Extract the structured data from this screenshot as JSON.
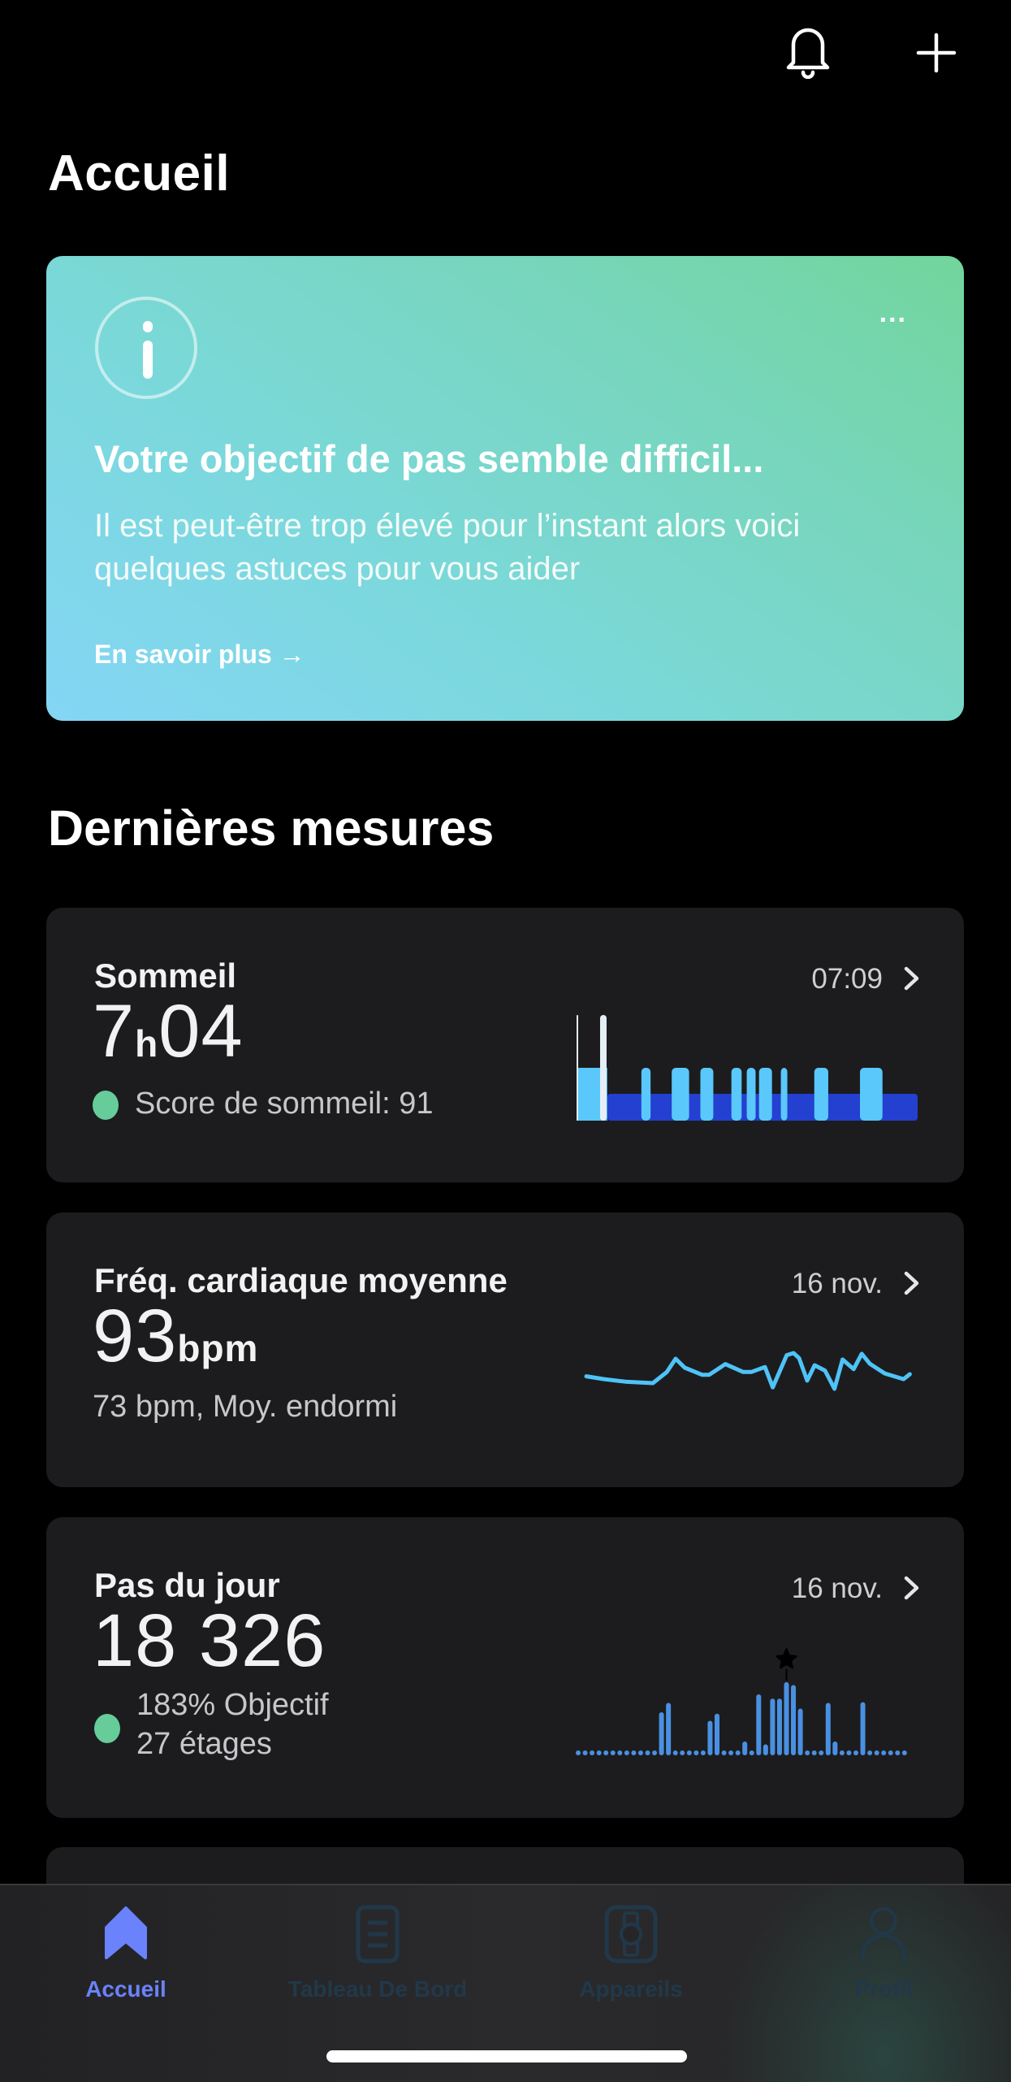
{
  "header": {
    "title": "Accueil",
    "icons": [
      "bell-icon",
      "plus-icon"
    ]
  },
  "banner": {
    "icon": "info-icon",
    "more_label": "...",
    "title": "Votre objectif de pas semble difficil...",
    "body": "Il est peut-être trop élevé pour l’instant alors voici quelques astuces pour vous aider",
    "link_label": "En savoir plus →",
    "gradient_colors": [
      "#84d6f5",
      "#72d59c"
    ]
  },
  "section": {
    "title": "Dernières mesures"
  },
  "cards": {
    "sleep": {
      "title": "Sommeil",
      "time": "07:09",
      "value_hours": "7",
      "value_h_unit": "h",
      "value_minutes": "04",
      "score_label": "Score de sommeil: 91",
      "status_color": "#66cc99"
    },
    "heart": {
      "title": "Fréq. cardiaque moyenne",
      "date": "16 nov.",
      "value": "93",
      "unit": "bpm",
      "sub_label": "73 bpm, Moy. endormi"
    },
    "steps": {
      "title": "Pas du jour",
      "date": "16 nov.",
      "value": "18 326",
      "goal_label": "183% Objectif",
      "floors_label": "27 étages",
      "status_color": "#66cc99"
    }
  },
  "chart_data": [
    {
      "name": "sleep-stages",
      "type": "bar",
      "title": "Sommeil",
      "x_unit": "fraction of night",
      "deep_base": {
        "start": 0.09,
        "end": 1.0,
        "color": "#2340d0"
      },
      "light_segments": [
        [
          0.0,
          0.09
        ],
        [
          0.19,
          0.217
        ],
        [
          0.279,
          0.33
        ],
        [
          0.363,
          0.401
        ],
        [
          0.454,
          0.484
        ],
        [
          0.499,
          0.525
        ],
        [
          0.535,
          0.573
        ],
        [
          0.599,
          0.618
        ],
        [
          0.697,
          0.738
        ],
        [
          0.831,
          0.897
        ]
      ],
      "light_color": "#5ac8fa",
      "awake_markers": [
        0.0,
        0.069
      ],
      "awake_color": "#e5eef5"
    },
    {
      "name": "heart-rate-trend",
      "type": "line",
      "title": "Fréq. cardiaque moyenne",
      "color": "#4fc3f7",
      "y_unit": "relative (0-1)",
      "x": [
        0.0,
        0.055,
        0.12,
        0.205,
        0.248,
        0.275,
        0.303,
        0.357,
        0.378,
        0.428,
        0.483,
        0.508,
        0.55,
        0.574,
        0.617,
        0.638,
        0.655,
        0.68,
        0.703,
        0.735,
        0.764,
        0.789,
        0.823,
        0.848,
        0.873,
        0.919,
        0.977,
        0.996
      ],
      "values": [
        0.35,
        0.27,
        0.2,
        0.16,
        0.47,
        0.84,
        0.59,
        0.39,
        0.39,
        0.69,
        0.47,
        0.47,
        0.61,
        0.04,
        0.94,
        1.0,
        0.86,
        0.23,
        0.66,
        0.51,
        0.0,
        0.82,
        0.55,
        0.98,
        0.7,
        0.43,
        0.27,
        0.41
      ]
    },
    {
      "name": "steps-by-interval",
      "type": "bar",
      "title": "Pas du jour",
      "color": "#4a90e2",
      "slots": 48,
      "y_unit": "relative (0-1)",
      "bars": [
        {
          "slot": 12,
          "value": 0.58
        },
        {
          "slot": 13,
          "value": 0.71
        },
        {
          "slot": 19,
          "value": 0.46
        },
        {
          "slot": 20,
          "value": 0.56
        },
        {
          "slot": 24,
          "value": 0.17
        },
        {
          "slot": 26,
          "value": 0.83
        },
        {
          "slot": 27,
          "value": 0.13
        },
        {
          "slot": 28,
          "value": 0.77
        },
        {
          "slot": 29,
          "value": 0.77
        },
        {
          "slot": 30,
          "value": 1.0
        },
        {
          "slot": 31,
          "value": 0.96
        },
        {
          "slot": 32,
          "value": 0.63
        },
        {
          "slot": 36,
          "value": 0.71
        },
        {
          "slot": 37,
          "value": 0.17
        },
        {
          "slot": 41,
          "value": 0.72
        }
      ],
      "peak_marker_slot": 30,
      "peak_marker_icon": "star-icon"
    }
  ],
  "nav": {
    "items": [
      {
        "label": "Accueil",
        "icon": "home-icon",
        "active": true
      },
      {
        "label": "Tableau De Bord",
        "icon": "dashboard-icon",
        "active": false
      },
      {
        "label": "Appareils",
        "icon": "watch-icon",
        "active": false
      },
      {
        "label": "Profil",
        "icon": "profile-icon",
        "active": false
      }
    ],
    "active_color": "#6a82fb",
    "inactive_color": "#21384a"
  }
}
